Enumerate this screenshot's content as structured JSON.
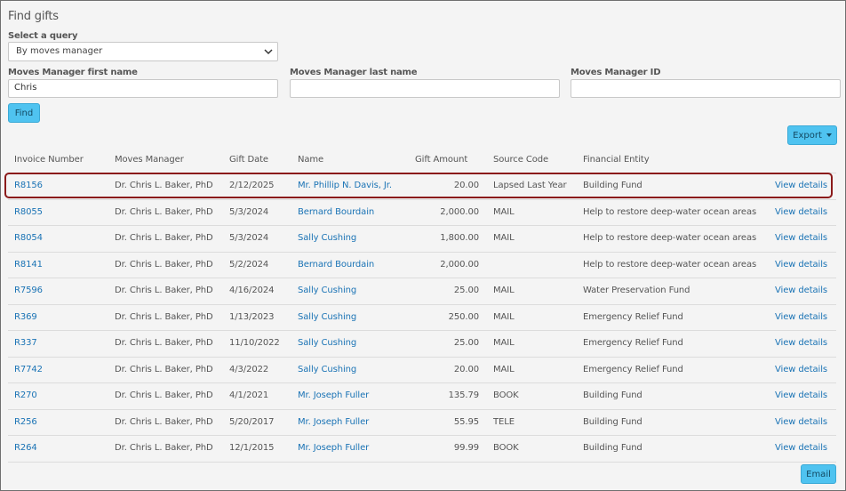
{
  "page": {
    "title": "Find gifts"
  },
  "query": {
    "label": "Select a query",
    "selected": "By moves manager"
  },
  "fields": {
    "first_name_label": "Moves Manager first name",
    "first_name_value": "Chris",
    "last_name_label": "Moves Manager last name",
    "last_name_value": "",
    "id_label": "Moves Manager ID",
    "id_value": ""
  },
  "buttons": {
    "find": "Find",
    "export": "Export",
    "email": "Email"
  },
  "table": {
    "headers": [
      "Invoice Number",
      "Moves Manager",
      "Gift Date",
      "Name",
      "Gift Amount",
      "Source Code",
      "Financial Entity"
    ],
    "view_label": "View details",
    "rows": [
      {
        "invoice": "R8156",
        "manager": "Dr. Chris L. Baker, PhD",
        "date": "2/12/2025",
        "name": "Mr. Phillip N. Davis, Jr.",
        "amount": "20.00",
        "source": "Lapsed Last Year",
        "entity": "Building Fund"
      },
      {
        "invoice": "R8055",
        "manager": "Dr. Chris L. Baker, PhD",
        "date": "5/3/2024",
        "name": "Bernard Bourdain",
        "amount": "2,000.00",
        "source": "MAIL",
        "entity": "Help to restore deep-water ocean areas"
      },
      {
        "invoice": "R8054",
        "manager": "Dr. Chris L. Baker, PhD",
        "date": "5/3/2024",
        "name": "Sally Cushing",
        "amount": "1,800.00",
        "source": "MAIL",
        "entity": "Help to restore deep-water ocean areas"
      },
      {
        "invoice": "R8141",
        "manager": "Dr. Chris L. Baker, PhD",
        "date": "5/2/2024",
        "name": "Bernard Bourdain",
        "amount": "2,000.00",
        "source": "",
        "entity": "Help to restore deep-water ocean areas"
      },
      {
        "invoice": "R7596",
        "manager": "Dr. Chris L. Baker, PhD",
        "date": "4/16/2024",
        "name": "Sally Cushing",
        "amount": "25.00",
        "source": "MAIL",
        "entity": "Water Preservation Fund"
      },
      {
        "invoice": "R369",
        "manager": "Dr. Chris L. Baker, PhD",
        "date": "1/13/2023",
        "name": "Sally Cushing",
        "amount": "250.00",
        "source": "MAIL",
        "entity": "Emergency Relief Fund"
      },
      {
        "invoice": "R337",
        "manager": "Dr. Chris L. Baker, PhD",
        "date": "11/10/2022",
        "name": "Sally Cushing",
        "amount": "25.00",
        "source": "MAIL",
        "entity": "Emergency Relief Fund"
      },
      {
        "invoice": "R7742",
        "manager": "Dr. Chris L. Baker, PhD",
        "date": "4/3/2022",
        "name": "Sally Cushing",
        "amount": "20.00",
        "source": "MAIL",
        "entity": "Emergency Relief Fund"
      },
      {
        "invoice": "R270",
        "manager": "Dr. Chris L. Baker, PhD",
        "date": "4/1/2021",
        "name": "Mr. Joseph Fuller",
        "amount": "135.79",
        "source": "BOOK",
        "entity": "Building Fund"
      },
      {
        "invoice": "R256",
        "manager": "Dr. Chris L. Baker, PhD",
        "date": "5/20/2017",
        "name": "Mr. Joseph Fuller",
        "amount": "55.95",
        "source": "TELE",
        "entity": "Building Fund"
      },
      {
        "invoice": "R264",
        "manager": "Dr. Chris L. Baker, PhD",
        "date": "12/1/2015",
        "name": "Mr. Joseph Fuller",
        "amount": "99.99",
        "source": "BOOK",
        "entity": "Building Fund"
      }
    ]
  },
  "colors": {
    "accent_button": "#4fc3f0",
    "link": "#1a73b5",
    "highlight_border": "#8b1a1a"
  },
  "icons": {
    "select_chevron": "chevron-down-icon",
    "export_caret": "caret-down-icon"
  }
}
